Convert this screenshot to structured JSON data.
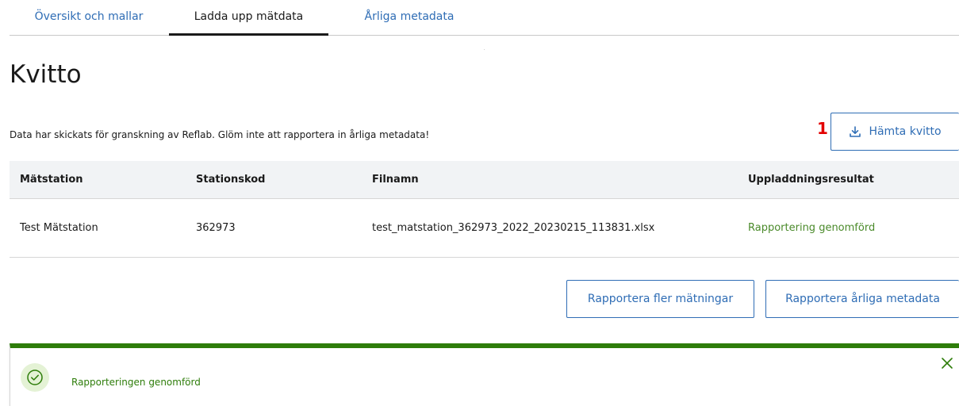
{
  "tabs": [
    {
      "label": "Översikt och mallar",
      "state": "link"
    },
    {
      "label": "Ladda upp mätdata",
      "state": "active"
    },
    {
      "label": "Årliga metadata",
      "state": "link"
    }
  ],
  "page": {
    "title": "Kvitto",
    "info": "Data har skickats för granskning av Reflab. Glöm inte att rapportera in årliga metadata!",
    "step_marker": "1"
  },
  "buttons": {
    "download_receipt": "Hämta kvitto",
    "report_more": "Rapportera fler mätningar",
    "report_metadata": "Rapportera årliga metadata"
  },
  "table": {
    "headers": [
      "Mätstation",
      "Stationskod",
      "Filnamn",
      "Uppladdningsresultat"
    ],
    "rows": [
      [
        "Test Mätstation",
        "362973",
        "test_matstation_362973_2022_20230215_113831.xlsx",
        "Rapportering genomförd"
      ]
    ]
  },
  "toast": {
    "message": "Rapporteringen genomförd"
  },
  "icons": {
    "download": "download-icon",
    "success": "check-circle-icon",
    "close": "close-icon"
  },
  "colors": {
    "link": "#2f6db5",
    "success": "#2e7d0a",
    "success_text": "#4a8a2a",
    "step_marker": "#e30000",
    "table_header_bg": "#f1f3f5"
  }
}
